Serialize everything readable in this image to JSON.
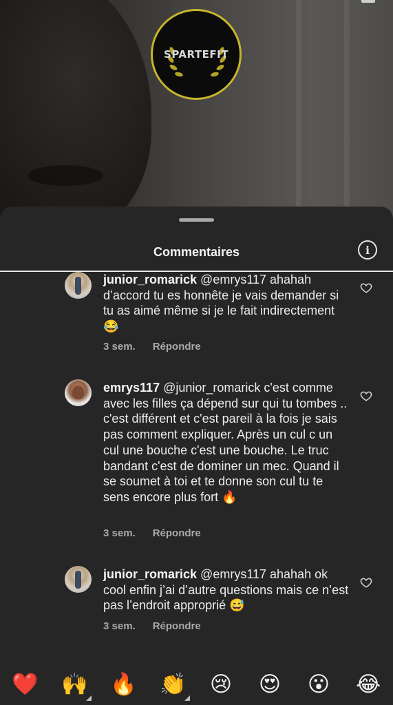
{
  "video": {
    "logo_text": "SPARTEFIT",
    "colors": {
      "logo_ring": "#c7b42c",
      "logo_bg": "#0b0b0b"
    }
  },
  "sheet": {
    "title": "Commentaires",
    "info_icon": "info-icon",
    "info_glyph": "i"
  },
  "comments": [
    {
      "username": "junior_romarick",
      "text": " @emrys117 ahahah d’accord tu es honnête je vais demander si tu as aimé même si je le fait indirectement 😂",
      "time": "3 sem.",
      "reply": "Répondre"
    },
    {
      "username": "emrys117",
      "text": " @junior_romarick c'est comme avec les filles ça dépend sur qui tu tombes .. c'est différent et c'est pareil à la fois je sais pas comment expliquer. Après un cul c un cul une bouche c'est une bouche. Le truc bandant c'est de dominer un mec. Quand il se soumet à toi et te donne son cul tu te sens encore plus fort 🔥",
      "time": "3 sem.",
      "reply": "Répondre"
    },
    {
      "username": "junior_romarick",
      "text": " @emrys117 ahahah ok cool enfin j’ai d’autre questions mais ce n’est pas l’endroit approprié 😅",
      "time": "3 sem.",
      "reply": "Répondre"
    }
  ],
  "emoji_bar": [
    "❤️",
    "🙌",
    "🔥",
    "👏",
    "😢",
    "😍",
    "😮",
    "😂"
  ]
}
